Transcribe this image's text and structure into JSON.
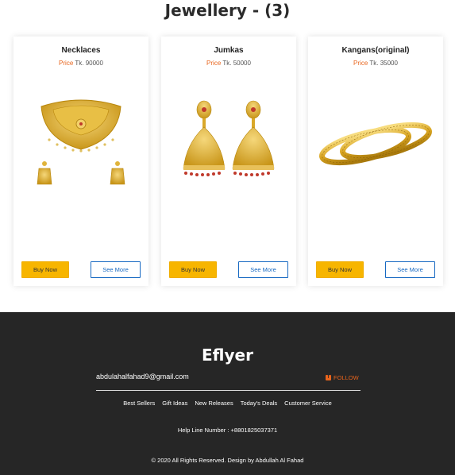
{
  "section": {
    "title": "Jewellery - (3)"
  },
  "products": [
    {
      "name": "Necklaces",
      "price_label": "Price",
      "price_value": "Tk. 90000",
      "buy_label": "Buy Now",
      "more_label": "See More"
    },
    {
      "name": "Jumkas",
      "price_label": "Price",
      "price_value": "Tk. 50000",
      "buy_label": "Buy Now",
      "more_label": "See More"
    },
    {
      "name": "Kangans(original)",
      "price_label": "Price",
      "price_value": "Tk. 35000",
      "buy_label": "Buy Now",
      "more_label": "See More"
    }
  ],
  "footer": {
    "brand": "Eflyer",
    "email": "abdulahalfahad9@gmail.com",
    "follow_label": "FOLLOW",
    "follow_icon": "facebook-icon",
    "nav": [
      "Best Sellers",
      "Gift Ideas",
      "New Releases",
      "Today's Deals",
      "Customer Service"
    ],
    "helpline": "Help Line Number : +8801825037371",
    "copyright": "© 2020 All Rights Reserved. Design by Abdullah Al Fahad"
  },
  "colors": {
    "accent_orange": "#e8641c",
    "buy_button": "#f7b500",
    "see_more_border": "#1769c2",
    "footer_bg": "#262626",
    "gold": "#d4a017"
  }
}
